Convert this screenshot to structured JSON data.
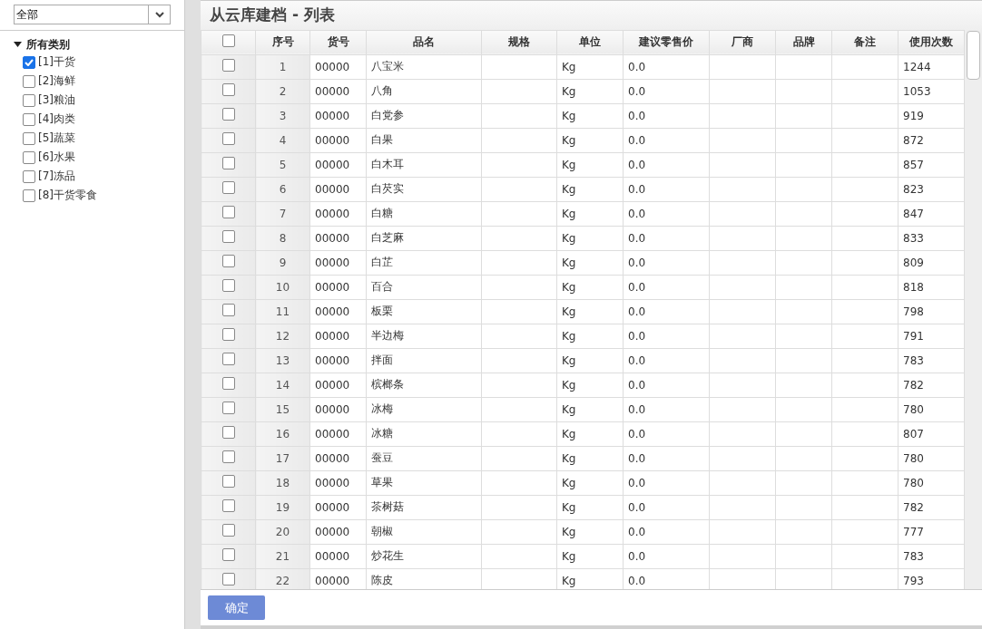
{
  "filter": {
    "value": "全部"
  },
  "tree": {
    "label": "所有类别",
    "expanded": true,
    "children": [
      {
        "label": "[1]干货",
        "checked": true
      },
      {
        "label": "[2]海鲜",
        "checked": false
      },
      {
        "label": "[3]粮油",
        "checked": false
      },
      {
        "label": "[4]肉类",
        "checked": false
      },
      {
        "label": "[5]蔬菜",
        "checked": false
      },
      {
        "label": "[6]水果",
        "checked": false
      },
      {
        "label": "[7]冻品",
        "checked": false
      },
      {
        "label": "[8]干货零食",
        "checked": false
      }
    ]
  },
  "title": "从云库建档 - 列表",
  "table": {
    "select_all": {
      "checked": false
    },
    "columns": [
      "序号",
      "货号",
      "品名",
      "规格",
      "单位",
      "建议零售价",
      "厂商",
      "品牌",
      "备注",
      "使用次数"
    ],
    "rows": [
      {
        "checked": false,
        "seq": "1",
        "code": "00000",
        "name": "八宝米",
        "unit": "Kg",
        "price": "0.0",
        "count": "1244"
      },
      {
        "checked": false,
        "seq": "2",
        "code": "00000",
        "name": "八角",
        "unit": "Kg",
        "price": "0.0",
        "count": "1053"
      },
      {
        "checked": false,
        "seq": "3",
        "code": "00000",
        "name": "白党参",
        "unit": "Kg",
        "price": "0.0",
        "count": "919"
      },
      {
        "checked": false,
        "seq": "4",
        "code": "00000",
        "name": "白果",
        "unit": "Kg",
        "price": "0.0",
        "count": "872"
      },
      {
        "checked": false,
        "seq": "5",
        "code": "00000",
        "name": "白木耳",
        "unit": "Kg",
        "price": "0.0",
        "count": "857"
      },
      {
        "checked": false,
        "seq": "6",
        "code": "00000",
        "name": "白芡实",
        "unit": "Kg",
        "price": "0.0",
        "count": "823"
      },
      {
        "checked": false,
        "seq": "7",
        "code": "00000",
        "name": "白糖",
        "unit": "Kg",
        "price": "0.0",
        "count": "847"
      },
      {
        "checked": false,
        "seq": "8",
        "code": "00000",
        "name": "白芝麻",
        "unit": "Kg",
        "price": "0.0",
        "count": "833"
      },
      {
        "checked": false,
        "seq": "9",
        "code": "00000",
        "name": "白芷",
        "unit": "Kg",
        "price": "0.0",
        "count": "809"
      },
      {
        "checked": false,
        "seq": "10",
        "code": "00000",
        "name": "百合",
        "unit": "Kg",
        "price": "0.0",
        "count": "818"
      },
      {
        "checked": false,
        "seq": "11",
        "code": "00000",
        "name": "板栗",
        "unit": "Kg",
        "price": "0.0",
        "count": "798"
      },
      {
        "checked": false,
        "seq": "12",
        "code": "00000",
        "name": "半边梅",
        "unit": "Kg",
        "price": "0.0",
        "count": "791"
      },
      {
        "checked": false,
        "seq": "13",
        "code": "00000",
        "name": "拌面",
        "unit": "Kg",
        "price": "0.0",
        "count": "783"
      },
      {
        "checked": false,
        "seq": "14",
        "code": "00000",
        "name": "槟榔条",
        "unit": "Kg",
        "price": "0.0",
        "count": "782"
      },
      {
        "checked": false,
        "seq": "15",
        "code": "00000",
        "name": "冰梅",
        "unit": "Kg",
        "price": "0.0",
        "count": "780"
      },
      {
        "checked": false,
        "seq": "16",
        "code": "00000",
        "name": "冰糖",
        "unit": "Kg",
        "price": "0.0",
        "count": "807"
      },
      {
        "checked": false,
        "seq": "17",
        "code": "00000",
        "name": "蚕豆",
        "unit": "Kg",
        "price": "0.0",
        "count": "780"
      },
      {
        "checked": false,
        "seq": "18",
        "code": "00000",
        "name": "草果",
        "unit": "Kg",
        "price": "0.0",
        "count": "780"
      },
      {
        "checked": false,
        "seq": "19",
        "code": "00000",
        "name": "茶树菇",
        "unit": "Kg",
        "price": "0.0",
        "count": "782"
      },
      {
        "checked": false,
        "seq": "20",
        "code": "00000",
        "name": "朝椒",
        "unit": "Kg",
        "price": "0.0",
        "count": "777"
      },
      {
        "checked": false,
        "seq": "21",
        "code": "00000",
        "name": "炒花生",
        "unit": "Kg",
        "price": "0.0",
        "count": "783"
      },
      {
        "checked": false,
        "seq": "22",
        "code": "00000",
        "name": "陈皮",
        "unit": "Kg",
        "price": "0.0",
        "count": "793"
      }
    ]
  },
  "confirm_button": "确定"
}
